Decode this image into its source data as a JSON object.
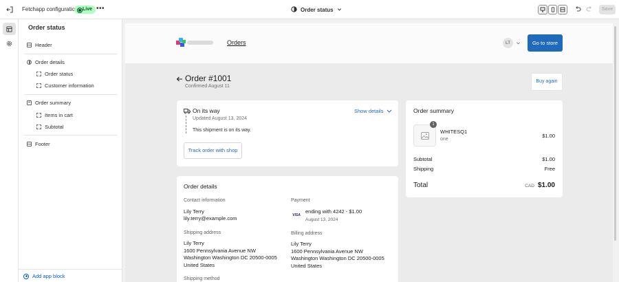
{
  "topbar": {
    "app_title": "Fetchapp configuration",
    "status_badge": "Live",
    "more_label": "•••",
    "template_selector": "Order status",
    "save_label": "Save"
  },
  "sidebar": {
    "title": "Order status",
    "items": [
      {
        "label": "Header"
      },
      {
        "label": "Order details"
      },
      {
        "label": "Order status"
      },
      {
        "label": "Customer information"
      },
      {
        "label": "Order summary"
      },
      {
        "label": "Items in cart"
      },
      {
        "label": "Subtotal"
      },
      {
        "label": "Footer"
      }
    ],
    "add_app_block": "Add app block"
  },
  "store_header": {
    "orders_link": "Orders",
    "avatar_initials": "LT",
    "go_to_store": "Go to store"
  },
  "order": {
    "title": "Order #1001",
    "confirmed": "Confirmed August 11",
    "buy_again": "Buy again"
  },
  "shipment": {
    "status": "On its way",
    "updated": "Updated August 13, 2024",
    "message": "This shipment is on its way.",
    "show_details": "Show details",
    "track_button": "Track order with shop"
  },
  "order_details": {
    "title": "Order details",
    "contact_label": "Contact information",
    "contact_name": "Lily Terry",
    "contact_email": "lily.terry@example.com",
    "payment_label": "Payment",
    "card_brand": "VISA",
    "payment_line": "ending with 4242 - $1.00",
    "payment_date": "August 13, 2024",
    "shipping_label": "Shipping address",
    "shipping_address": [
      "Lily Terry",
      "1600 Pennsylvania Avenue NW",
      "Washington Washington DC 20500-0005",
      "United States"
    ],
    "billing_label": "Billing address",
    "billing_address": [
      "Lily Terry",
      "1600 Pennsylvania Avenue NW",
      "Washington Washington DC 20500-0005",
      "United States"
    ],
    "shipping_method_label": "Shipping method"
  },
  "summary": {
    "title": "Order summary",
    "item": {
      "name": "WHITESQ1",
      "variant": "one",
      "quantity": "1",
      "price": "$1.00"
    },
    "subtotal_label": "Subtotal",
    "subtotal_value": "$1.00",
    "shipping_label": "Shipping",
    "shipping_value": "Free",
    "total_label": "Total",
    "currency": "CAD",
    "total_value": "$1.00"
  },
  "colors": {
    "accent": "#1f6ab9",
    "live_badge_bg": "#affebf",
    "link_blue": "#005bd3"
  }
}
